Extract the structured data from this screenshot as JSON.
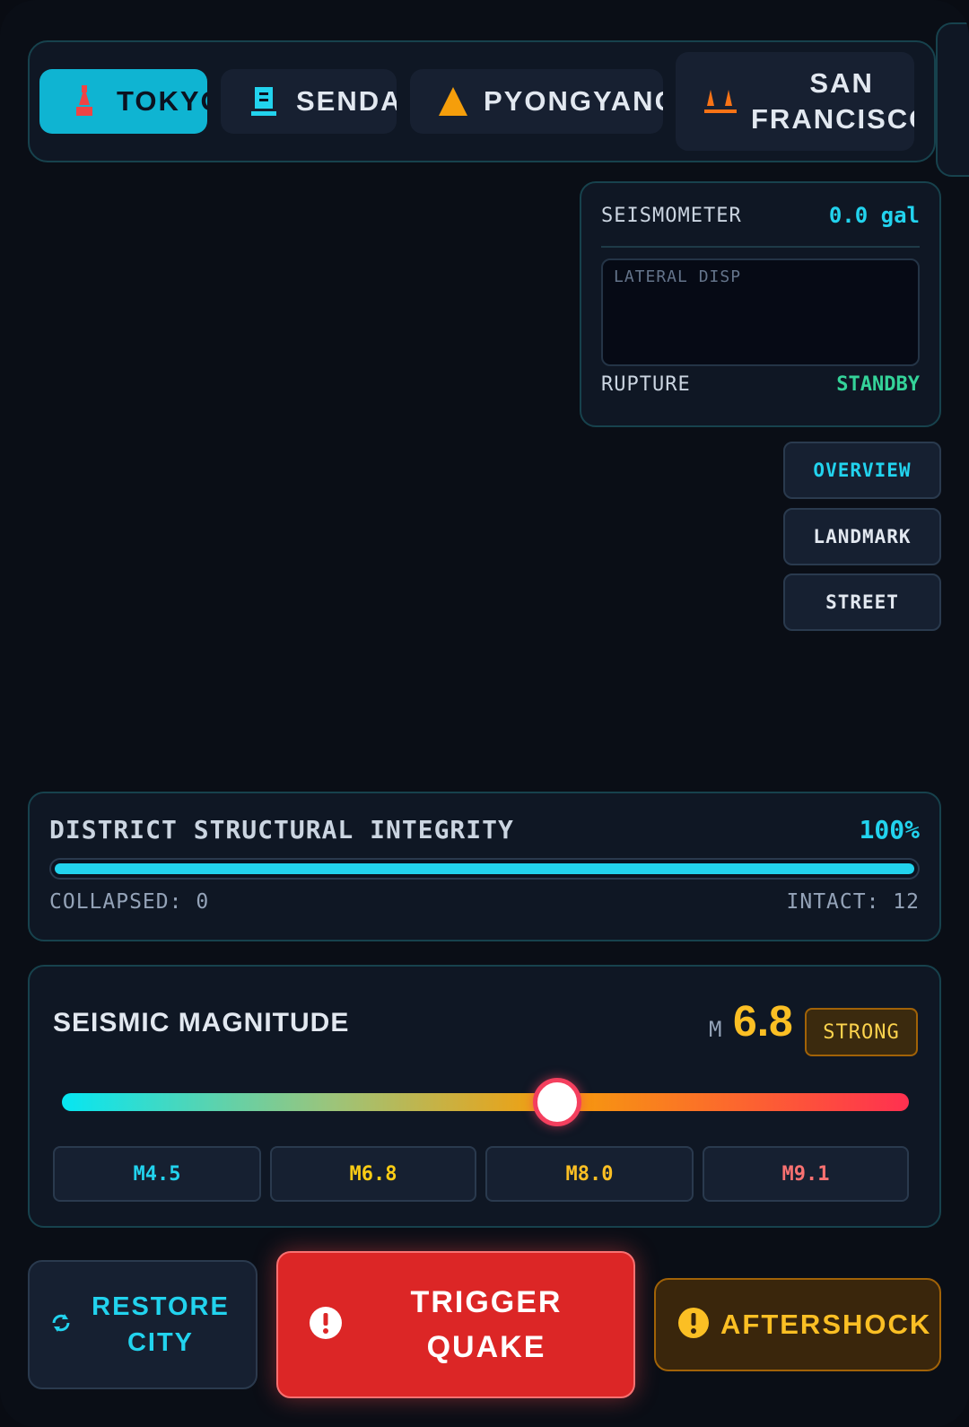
{
  "cities": [
    {
      "name": "TOKYO",
      "icon": "tower-icon",
      "active": true
    },
    {
      "name": "SENDAI",
      "icon": "building-icon",
      "active": false
    },
    {
      "name": "PYONGYANG",
      "icon": "pyramid-icon",
      "active": false
    },
    {
      "name": "SAN\nFRANCISCO",
      "icon": "bridge-icon",
      "active": false
    }
  ],
  "seismometer": {
    "label": "SEISMOMETER",
    "value": "0.0 gal",
    "graph_label": "LATERAL DISP",
    "rupture_label": "RUPTURE",
    "rupture_status": "STANDBY"
  },
  "views": [
    "OVERVIEW",
    "LANDMARK",
    "STREET"
  ],
  "active_view": "OVERVIEW",
  "integrity": {
    "title": "DISTRICT STRUCTURAL INTEGRITY",
    "percent_text": "100%",
    "percent": 100,
    "collapsed_text": "COLLAPSED: 0",
    "intact_text": "INTACT: 12"
  },
  "magnitude": {
    "title": "SEISMIC MAGNITUDE",
    "prefix": "M",
    "value_text": "6.8",
    "value": 6.8,
    "range": [
      3.0,
      9.5
    ],
    "badge": "STRONG",
    "presets": [
      {
        "label": "M4.5",
        "color": "#22d3ee"
      },
      {
        "label": "M6.8",
        "color": "#facc15"
      },
      {
        "label": "M8.0",
        "color": "#fbbf24"
      },
      {
        "label": "M9.1",
        "color": "#f87171"
      }
    ]
  },
  "actions": {
    "restore": "RESTORE CITY",
    "trigger": "TRIGGER QUAKE",
    "aftershock": "AFTERSHOCK"
  },
  "colors": {
    "accent": "#22d3ee",
    "danger": "#dc2626",
    "warning": "#fbbf24",
    "ok": "#34d399"
  }
}
